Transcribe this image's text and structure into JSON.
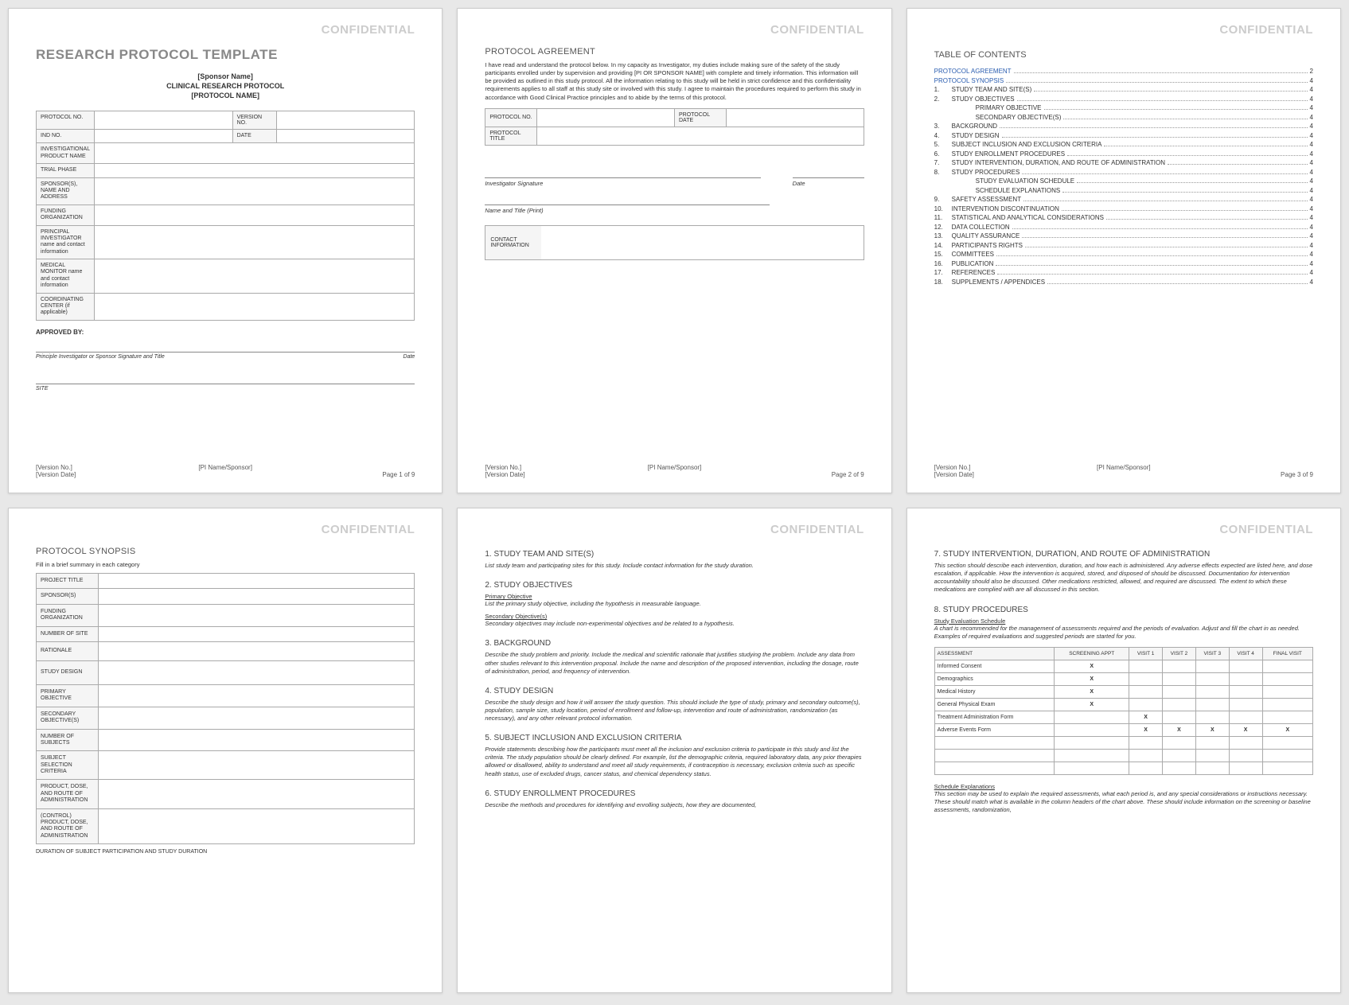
{
  "confidential": "CONFIDENTIAL",
  "footer": {
    "version_no": "[Version No.]",
    "version_date": "[Version Date]",
    "pi": "[PI Name/Sponsor]",
    "page_prefix": "Page ",
    "page_suffix": " of 9"
  },
  "page1": {
    "title": "RESEARCH PROTOCOL TEMPLATE",
    "sponsor": "[Sponsor Name]",
    "crp": "CLINICAL RESEARCH PROTOCOL",
    "protocol_name": "[PROTOCOL NAME]",
    "rows": [
      {
        "l1": "PROTOCOL NO.",
        "l2": "VERSION NO."
      },
      {
        "l1": "IND NO.",
        "l2": "DATE"
      }
    ],
    "single_rows": [
      "INVESTIGATIONAL PRODUCT NAME",
      "TRIAL PHASE",
      "SPONSOR(S), NAME AND ADDRESS",
      "FUNDING ORGANIZATION",
      "PRINCIPAL INVESTIGATOR name and contact information",
      "MEDICAL MONITOR name and contact information",
      "COORDINATING CENTER (if applicable)"
    ],
    "approved": "APPROVED BY:",
    "sig1_l": "Principle Investigator or Sponsor Signature and Title",
    "sig1_r": "Date",
    "sig2": "SITE"
  },
  "page2": {
    "title": "PROTOCOL AGREEMENT",
    "body": "I have read and understand the protocol below. In my capacity as Investigator, my duties include making sure of the safety of the study participants enrolled under by supervision and providing [PI OR SPONSOR NAME] with complete and timely information. This information will be provided as outlined in this study protocol. All the information relating to this study will be held in strict confidence and this confidentiality requirements applies to all staff at this study site or involved with this study. I agree to maintain the procedures required to perform this study in accordance with Good Clinical Practice principles and to abide by the terms of this protocol.",
    "t_protocol_no": "PROTOCOL NO.",
    "t_protocol_date": "PROTOCOL DATE",
    "t_protocol_title": "PROTOCOL TITLE",
    "sig_inv": "Investigator Signature",
    "sig_date": "Date",
    "sig_name": "Name and Title (Print)",
    "contact": "CONTACT INFORMATION"
  },
  "page3": {
    "title": "TABLE OF CONTENTS",
    "links": [
      {
        "txt": "PROTOCOL AGREEMENT",
        "pg": "2"
      },
      {
        "txt": "PROTOCOL SYNOPSIS",
        "pg": "4"
      }
    ],
    "items": [
      {
        "n": "1.",
        "txt": "STUDY TEAM AND SITE(S)",
        "pg": "4"
      },
      {
        "n": "2.",
        "txt": "STUDY OBJECTIVES",
        "pg": "4"
      },
      {
        "n": "",
        "txt": "PRIMARY OBJECTIVE",
        "pg": "4",
        "indent": true
      },
      {
        "n": "",
        "txt": "SECONDARY OBJECTIVE(S)",
        "pg": "4",
        "indent": true
      },
      {
        "n": "3.",
        "txt": "BACKGROUND",
        "pg": "4"
      },
      {
        "n": "4.",
        "txt": "STUDY DESIGN",
        "pg": "4"
      },
      {
        "n": "5.",
        "txt": "SUBJECT INCLUSION AND EXCLUSION CRITERIA",
        "pg": "4"
      },
      {
        "n": "6.",
        "txt": "STUDY ENROLLMENT PROCEDURES",
        "pg": "4"
      },
      {
        "n": "7.",
        "txt": "STUDY INTERVENTION, DURATION, AND ROUTE OF ADMINISTRATION",
        "pg": "4"
      },
      {
        "n": "8.",
        "txt": "STUDY PROCEDURES",
        "pg": "4"
      },
      {
        "n": "",
        "txt": "STUDY EVALUATION SCHEDULE",
        "pg": "4",
        "indent": true
      },
      {
        "n": "",
        "txt": "SCHEDULE EXPLANATIONS",
        "pg": "4",
        "indent": true
      },
      {
        "n": "9.",
        "txt": "SAFETY ASSESSMENT",
        "pg": "4"
      },
      {
        "n": "10.",
        "txt": "INTERVENTION DISCONTINUATION",
        "pg": "4"
      },
      {
        "n": "11.",
        "txt": "STATISTICAL AND ANALYTICAL CONSIDERATIONS",
        "pg": "4"
      },
      {
        "n": "12.",
        "txt": "DATA COLLECTION",
        "pg": "4"
      },
      {
        "n": "13.",
        "txt": "QUALITY ASSURANCE",
        "pg": "4"
      },
      {
        "n": "14.",
        "txt": "PARTICIPANTS RIGHTS",
        "pg": "4"
      },
      {
        "n": "15.",
        "txt": "COMMITTEES",
        "pg": "4"
      },
      {
        "n": "16.",
        "txt": "PUBLICATION",
        "pg": "4"
      },
      {
        "n": "17.",
        "txt": "REFERENCES",
        "pg": "4"
      },
      {
        "n": "18.",
        "txt": "SUPPLEMENTS / APPENDICES",
        "pg": "4"
      }
    ]
  },
  "page4": {
    "title": "PROTOCOL SYNOPSIS",
    "instr": "Fill in a brief summary in each category",
    "rows": [
      "PROJECT TITLE",
      "SPONSOR(S)",
      "FUNDING ORGANIZATION",
      "NUMBER OF SITE",
      "RATIONALE",
      "STUDY DESIGN",
      "PRIMARY OBJECTIVE",
      "SECONDARY OBJECTIVE(S)",
      "NUMBER OF SUBJECTS",
      "SUBJECT SELECTION CRITERIA",
      "PRODUCT, DOSE, AND ROUTE OF ADMINISTRATION",
      "(CONTROL) PRODUCT, DOSE, AND ROUTE OF ADMINISTRATION"
    ],
    "bottom": "DURATION OF SUBJECT PARTICIPATION AND STUDY DURATION"
  },
  "page5": {
    "s1_h": "1. STUDY TEAM AND SITE(S)",
    "s1_b": "List study team and participating sites for this study. Include contact information for the study duration.",
    "s2_h": "2. STUDY OBJECTIVES",
    "s2_po": "Primary Objective",
    "s2_po_b": "List the primary study objective, including the hypothesis in measurable language.",
    "s2_so": "Secondary Objective(s)",
    "s2_so_b": "Secondary objectives may include non-experimental objectives and be related to a hypothesis.",
    "s3_h": "3. BACKGROUND",
    "s3_b": "Describe the study problem and priority. Include the medical and scientific rationale that justifies studying the problem. Include any data from other studies relevant to this intervention proposal. Include the name and description of the proposed intervention, including the dosage, route of administration, period, and frequency of intervention.",
    "s4_h": "4. STUDY DESIGN",
    "s4_b": "Describe the study design and how it will answer the study question. This should include the type of study, primary and secondary outcome(s), population, sample size, study location, period of enrollment and follow-up, intervention and route of administration, randomization (as necessary), and any other relevant protocol information.",
    "s5_h": "5. SUBJECT INCLUSION AND EXCLUSION CRITERIA",
    "s5_b": "Provide statements describing how the participants must meet all the inclusion and exclusion criteria to participate in this study and list the criteria. The study population should be clearly defined. For example, list the demographic criteria, required laboratory data, any prior therapies allowed or disallowed, ability to understand and meet all study requirements, if contraception is necessary, exclusion criteria such as specific health status, use of excluded drugs, cancer status, and chemical dependency status.",
    "s6_h": "6. STUDY ENROLLMENT PROCEDURES",
    "s6_b": "Describe the methods and procedures for identifying and enrolling subjects, how they are documented,"
  },
  "page6": {
    "s7_h": "7. STUDY INTERVENTION, DURATION, AND ROUTE OF ADMINISTRATION",
    "s7_b": "This section should describe each intervention, duration, and how each is administered. Any adverse effects expected are listed here, and dose escalation, if applicable. How the intervention is acquired, stored, and disposed of should be discussed. Documentation for intervention accountability should also be discussed. Other medications restricted, allowed, and required are discussed. The extent to which these medications are complied with are all discussed in this section.",
    "s8_h": "8. STUDY PROCEDURES",
    "s8_sub": "Study Evaluation Schedule",
    "s8_b": "A chart is recommended for the management of assessments required and the periods of evaluation. Adjust and fill the chart in as needed. Examples of required evaluations and suggested periods are started for you.",
    "headers": [
      "ASSESSMENT",
      "SCREENING APPT",
      "VISIT 1",
      "VISIT 2",
      "VISIT 3",
      "VISIT 4",
      "FINAL VISIT"
    ],
    "rows": [
      {
        "a": "Informed Consent",
        "v": [
          "X",
          "",
          "",
          "",
          "",
          ""
        ]
      },
      {
        "a": "Demographics",
        "v": [
          "X",
          "",
          "",
          "",
          "",
          ""
        ]
      },
      {
        "a": "Medical History",
        "v": [
          "X",
          "",
          "",
          "",
          "",
          ""
        ]
      },
      {
        "a": "General Physical Exam",
        "v": [
          "X",
          "",
          "",
          "",
          "",
          ""
        ]
      },
      {
        "a": "Treatment Administration Form",
        "v": [
          "",
          "X",
          "",
          "",
          "",
          ""
        ]
      },
      {
        "a": "Adverse Events Form",
        "v": [
          "",
          "X",
          "X",
          "X",
          "X",
          "X"
        ]
      },
      {
        "a": "",
        "v": [
          "",
          "",
          "",
          "",
          "",
          ""
        ]
      },
      {
        "a": "",
        "v": [
          "",
          "",
          "",
          "",
          "",
          ""
        ]
      },
      {
        "a": "",
        "v": [
          "",
          "",
          "",
          "",
          "",
          ""
        ]
      }
    ],
    "sched_h": "Schedule Explanations",
    "sched_b": "This section may be used to explain the required assessments, what each period is, and any special considerations or instructions necessary. These should match what is available in the column headers of the chart above. These should include information on the screening or baseline assessments, randomization,"
  }
}
